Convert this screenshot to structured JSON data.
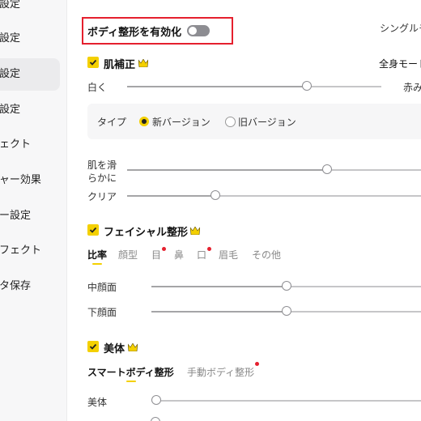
{
  "sidebar": {
    "items": [
      {
        "label": "本設定"
      },
      {
        "label": "一設定"
      },
      {
        "label": "顔設定"
      },
      {
        "label": "ク設定"
      },
      {
        "label": "フェクト"
      },
      {
        "label": "チャー効果"
      },
      {
        "label": "キー設定"
      },
      {
        "label": "エフェクト"
      },
      {
        "label": "ータ保存"
      }
    ],
    "active_index": 2
  },
  "body_shaping": {
    "toggle_label": "ボディ整形を有効化",
    "toggle_on": false,
    "right_label": "シングルモ"
  },
  "skin": {
    "title": "肌補正",
    "right_label": "全身モード",
    "white_label": "白く",
    "red_label": "赤み",
    "white_value": 0.75,
    "type_label": "タイプ",
    "new_version": "新バージョン",
    "old_version": "旧バージョン",
    "smooth_label_1": "肌を滑",
    "smooth_label_2": "らかに",
    "smooth_value": 0.68,
    "clear_label": "クリア",
    "clear_value": 0.3
  },
  "facial": {
    "title": "フェイシャル整形",
    "tabs": [
      {
        "label": "比率",
        "active": true
      },
      {
        "label": "顔型"
      },
      {
        "label": "目",
        "dot": true
      },
      {
        "label": "鼻"
      },
      {
        "label": "口",
        "dot": true
      },
      {
        "label": "眉毛"
      },
      {
        "label": "その他"
      }
    ],
    "mid_face_label": "中顔面",
    "mid_face_value": 0.5,
    "lower_face_label": "下顔面",
    "lower_face_value": 0.5
  },
  "beauty": {
    "title": "美体",
    "tab_smart": "スマートボディ整形",
    "tab_manual": "手動ボディ整形",
    "slider_label": "美体",
    "slider_value": 0
  },
  "colors": {
    "accent": "#f4d000",
    "highlight_box": "#e5202e"
  }
}
